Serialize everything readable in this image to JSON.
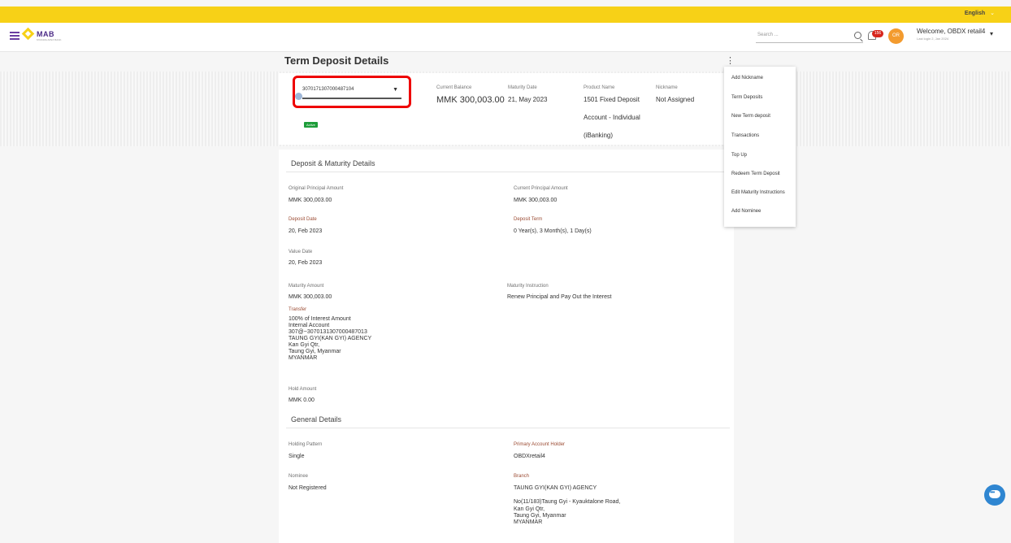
{
  "topbar": {
    "language": "English"
  },
  "header": {
    "logo_text": "MAB",
    "logo_sub": "MYANMA APEX BANK",
    "search_placeholder": "Search ...",
    "notification_count": "156",
    "avatar_initials": "OR",
    "welcome": "Welcome, OBDX retail4",
    "last_login": "Last login 2, Jan 2024"
  },
  "page": {
    "title": "Term Deposit Details"
  },
  "account": {
    "number": "3070171307000487104",
    "status": "Active",
    "current_balance_label": "Current Balance",
    "current_balance": "MMK 300,003.00",
    "maturity_date_label": "Maturity Date",
    "maturity_date": "21, May 2023",
    "product_name_label": "Product Name",
    "product_name_lines": [
      "1501 Fixed Deposit",
      "Account - Individual",
      "(iBanking)"
    ],
    "nickname_label": "Nickname",
    "nickname": "Not Assigned"
  },
  "deposit": {
    "section_title": "Deposit & Maturity Details",
    "original_principal_label": "Original Principal Amount",
    "original_principal": "MMK 300,003.00",
    "current_principal_label": "Current Principal Amount",
    "current_principal": "MMK 300,003.00",
    "deposit_date_label": "Deposit Date",
    "deposit_date": "20, Feb 2023",
    "deposit_term_label": "Deposit Term",
    "deposit_term": "0 Year(s), 3 Month(s), 1 Day(s)",
    "value_date_label": "Value Date",
    "value_date": "20, Feb 2023",
    "maturity_amount_label": "Maturity Amount",
    "maturity_amount": "MMK 300,003.00",
    "maturity_instruction_label": "Maturity Instruction",
    "maturity_instruction": "Renew Principal and Pay Out the Interest",
    "transfer_label": "Transfer",
    "transfer_lines": [
      "100% of Interest Amount",
      "Internal Account",
      "307@~3070131307000487013",
      "TAUNG GYI(KAN GYI) AGENCY",
      "Kan Gyi Qtr,",
      "Taung Gyi, Myanmar",
      "MYANMAR"
    ],
    "hold_amount_label": "Hold Amount",
    "hold_amount": "MMK 0.00"
  },
  "general": {
    "section_title": "General Details",
    "holding_pattern_label": "Holding Pattern",
    "holding_pattern": "Single",
    "primary_holder_label": "Primary Account Holder",
    "primary_holder": "OBDXretail4",
    "nominee_label": "Nominee",
    "nominee": "Not Registered",
    "branch_label": "Branch",
    "branch": "TAUNG GYI(KAN GYI) AGENCY",
    "branch_address_lines": [
      "No(11/183)Taung Gyi - Kyauktalone Road,",
      "Kan Gyi Qtr,",
      "Taung Gyi, Myanmar",
      "MYANMAR"
    ]
  },
  "menu": {
    "items": [
      "Add Nickname",
      "Term Deposits",
      "New Term deposit",
      "Transactions",
      "Top Up",
      "Redeem Term Deposit",
      "Edit Maturity Instructions",
      "Add Nominee"
    ]
  },
  "icons": [
    "hamburger-icon",
    "search-icon",
    "bell-icon",
    "kebab-icon",
    "chat-icon",
    "chevron-down-icon"
  ],
  "colors": {
    "brand_yellow": "#f7d117",
    "brand_purple": "#4b2a86",
    "active_green": "#1e9d3a",
    "highlight_red": "#e00000",
    "chat_blue": "#2f86d1"
  }
}
